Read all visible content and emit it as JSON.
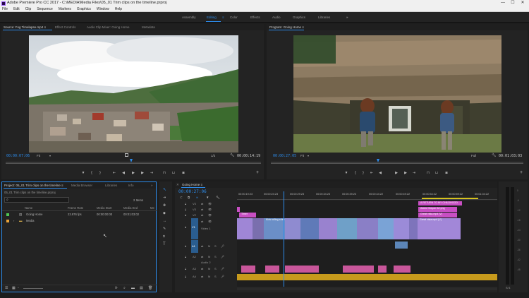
{
  "titlebar": {
    "title": "Adobe Premiere Pro CC 2017 - C:\\MEDIA\\Media Files\\05_01 Trim clips on the timeline.prproj",
    "minimize": "—",
    "maximize": "☐",
    "close": "✕"
  },
  "menu": [
    "File",
    "Edit",
    "Clip",
    "Sequence",
    "Markers",
    "Graphics",
    "Window",
    "Help"
  ],
  "workspaces": {
    "items": [
      "Assembly",
      "Editing",
      "Color",
      "Effects",
      "Audio",
      "Graphics",
      "Libraries"
    ],
    "active": "Editing",
    "more": "»"
  },
  "source": {
    "tabs": [
      "Source: Fog Timelapse.mp4 ≡",
      "Effect Controls",
      "Audio Clip Mixer: Going Home",
      "Metadata"
    ],
    "timecode": "00:00:07:06",
    "fit": "Fit",
    "resolution": "1/2",
    "duration": "00:00:14:19"
  },
  "program": {
    "tabs": [
      "Program: Going Home ≡"
    ],
    "timecode": "00:00:27:05",
    "fit": "Fit",
    "resolution": "Full",
    "duration": "00:01:03:03"
  },
  "project": {
    "tabs": [
      "Project: 05_01 Trim clips on the timeline ≡",
      "Media Browser",
      "Libraries",
      "Info",
      "»"
    ],
    "file": "05_01 Trim clips on the timeline.prproj",
    "items_count": "2 Items",
    "columns": [
      "Name",
      "Frame Rate",
      "Media Start",
      "Media End",
      "Me"
    ],
    "rows": [
      {
        "name": "Going Home",
        "frame_rate": "23.976 fps",
        "media_start": "00:00:00:00",
        "media_end": "00:01:03:02",
        "color": "#4fc552"
      },
      {
        "name": "Media",
        "frame_rate": "",
        "media_start": "",
        "media_end": "",
        "color": "#e8a33a"
      }
    ]
  },
  "timeline": {
    "tab": "Going Home ≡",
    "timecode": "00:00:27:06",
    "ruler": [
      "00:00:19:23",
      "00:00:24:23",
      "00:00:29:23",
      "00:00:34:23",
      "00:00:39:23",
      "00:00:44:22",
      "00:00:49:22",
      "00:00:54:22",
      "00:00:59:22",
      "00:01:04:22"
    ],
    "tracks": {
      "v3": "V3",
      "v2": "V2",
      "v1": "V1",
      "video1": "Video 1",
      "a1": "A1",
      "a2": "A2",
      "audio2": "Audio 2",
      "a3": "A3",
      "a4": "A4"
    },
    "clips": {
      "timer": "Timer",
      "return_title": "A RETURN TO MY CHILDHOOD",
      "adobe_mayan": "Adobe Mayan Art.png",
      "great_vista_v2": "Great vista.mp4 [V]",
      "kids_rolling": "Kids rolling a tire.mp4",
      "great_vista_v1": "Great vista.mp4 [V]"
    }
  },
  "meters": {
    "labels": [
      "0",
      "-6",
      "-12",
      "-18",
      "-24",
      "-30",
      "-36",
      "-42",
      "-48",
      "-54"
    ],
    "solo": "S  S"
  }
}
